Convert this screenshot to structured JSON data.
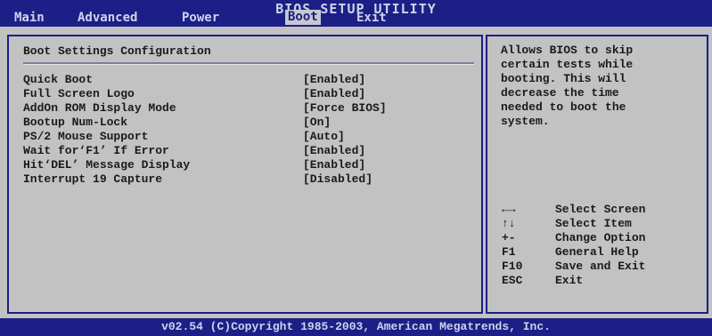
{
  "header": {
    "title": "BIOS SETUP UTILITY",
    "tabs": [
      {
        "label": "Main"
      },
      {
        "label": "Advanced"
      },
      {
        "label": "Power"
      },
      {
        "label": "Boot"
      },
      {
        "label": "Exit"
      }
    ],
    "active_tab": "Boot"
  },
  "section": {
    "title": "Boot Settings Configuration"
  },
  "settings": [
    {
      "label": "Quick Boot",
      "value": "[Enabled]"
    },
    {
      "label": "Full Screen Logo",
      "value": "[Enabled]"
    },
    {
      "label": "AddOn ROM Display Mode",
      "value": "[Force BIOS]"
    },
    {
      "label": "Bootup Num-Lock",
      "value": "[On]"
    },
    {
      "label": "PS/2 Mouse Support",
      "value": "[Auto]"
    },
    {
      "label": "Wait for‘F1’ If Error",
      "value": "[Enabled]"
    },
    {
      "label": "Hit‘DEL’ Message Display",
      "value": "[Enabled]"
    },
    {
      "label": "Interrupt 19 Capture",
      "value": "[Disabled]"
    }
  ],
  "help": {
    "text": "Allows BIOS to skip\ncertain tests while\nbooting. This will\ndecrease the time\nneeded to boot the\nsystem."
  },
  "keys": [
    {
      "key": "←→",
      "desc": "Select Screen"
    },
    {
      "key": "↑↓",
      "desc": "Select Item"
    },
    {
      "key": "+-",
      "desc": "Change Option"
    },
    {
      "key": "F1",
      "desc": "General Help"
    },
    {
      "key": "F10",
      "desc": "Save and Exit"
    },
    {
      "key": "ESC",
      "desc": "Exit"
    }
  ],
  "footer": {
    "text": "v02.54 (C)Copyright 1985-2003, American Megatrends, Inc."
  },
  "colors": {
    "header_bg": "#1b1f86",
    "panel_bg": "#c2c2c2",
    "border": "#1b1f86"
  }
}
